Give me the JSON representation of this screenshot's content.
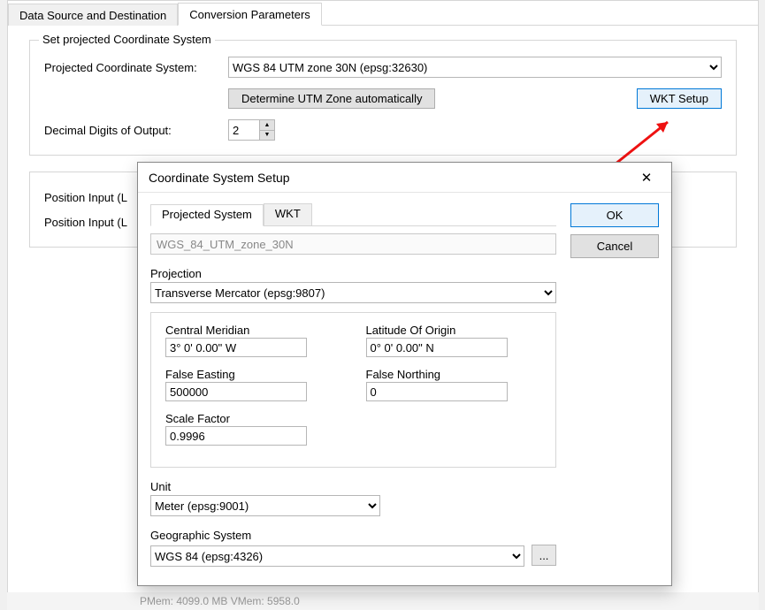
{
  "tabs": {
    "data_source": "Data Source and Destination",
    "conversion_params": "Conversion Parameters"
  },
  "bg": {
    "fieldset_title": "Set projected Coordinate System",
    "pcs_label": "Projected Coordinate System:",
    "pcs_value": "WGS 84 UTM zone 30N (epsg:32630)",
    "determine_btn": "Determine UTM Zone automatically",
    "wkt_setup_btn": "WKT Setup",
    "digits_label": "Decimal Digits of Output:",
    "digits_value": "2",
    "pos_input_a": "Position Input (L",
    "pos_input_b": "Position Input (L"
  },
  "statusbar": "PMem: 4099.0 MB  VMem: 5958.0",
  "dialog": {
    "title": "Coordinate System Setup",
    "ok": "OK",
    "cancel": "Cancel",
    "tabs": {
      "projected": "Projected System",
      "wkt": "WKT"
    },
    "name_value": "WGS_84_UTM_zone_30N",
    "projection_label": "Projection",
    "projection_value": "Transverse Mercator (epsg:9807)",
    "params": {
      "central_meridian_label": "Central Meridian",
      "central_meridian_value": "3° 0' 0.00\" W",
      "lat_origin_label": "Latitude Of Origin",
      "lat_origin_value": "0° 0' 0.00\" N",
      "false_easting_label": "False Easting",
      "false_easting_value": "500000",
      "false_northing_label": "False Northing",
      "false_northing_value": "0",
      "scale_factor_label": "Scale Factor",
      "scale_factor_value": "0.9996"
    },
    "unit_label": "Unit",
    "unit_value": "Meter (epsg:9001)",
    "geo_label": "Geographic System",
    "geo_value": "WGS 84 (epsg:4326)",
    "ellipsis": "..."
  }
}
